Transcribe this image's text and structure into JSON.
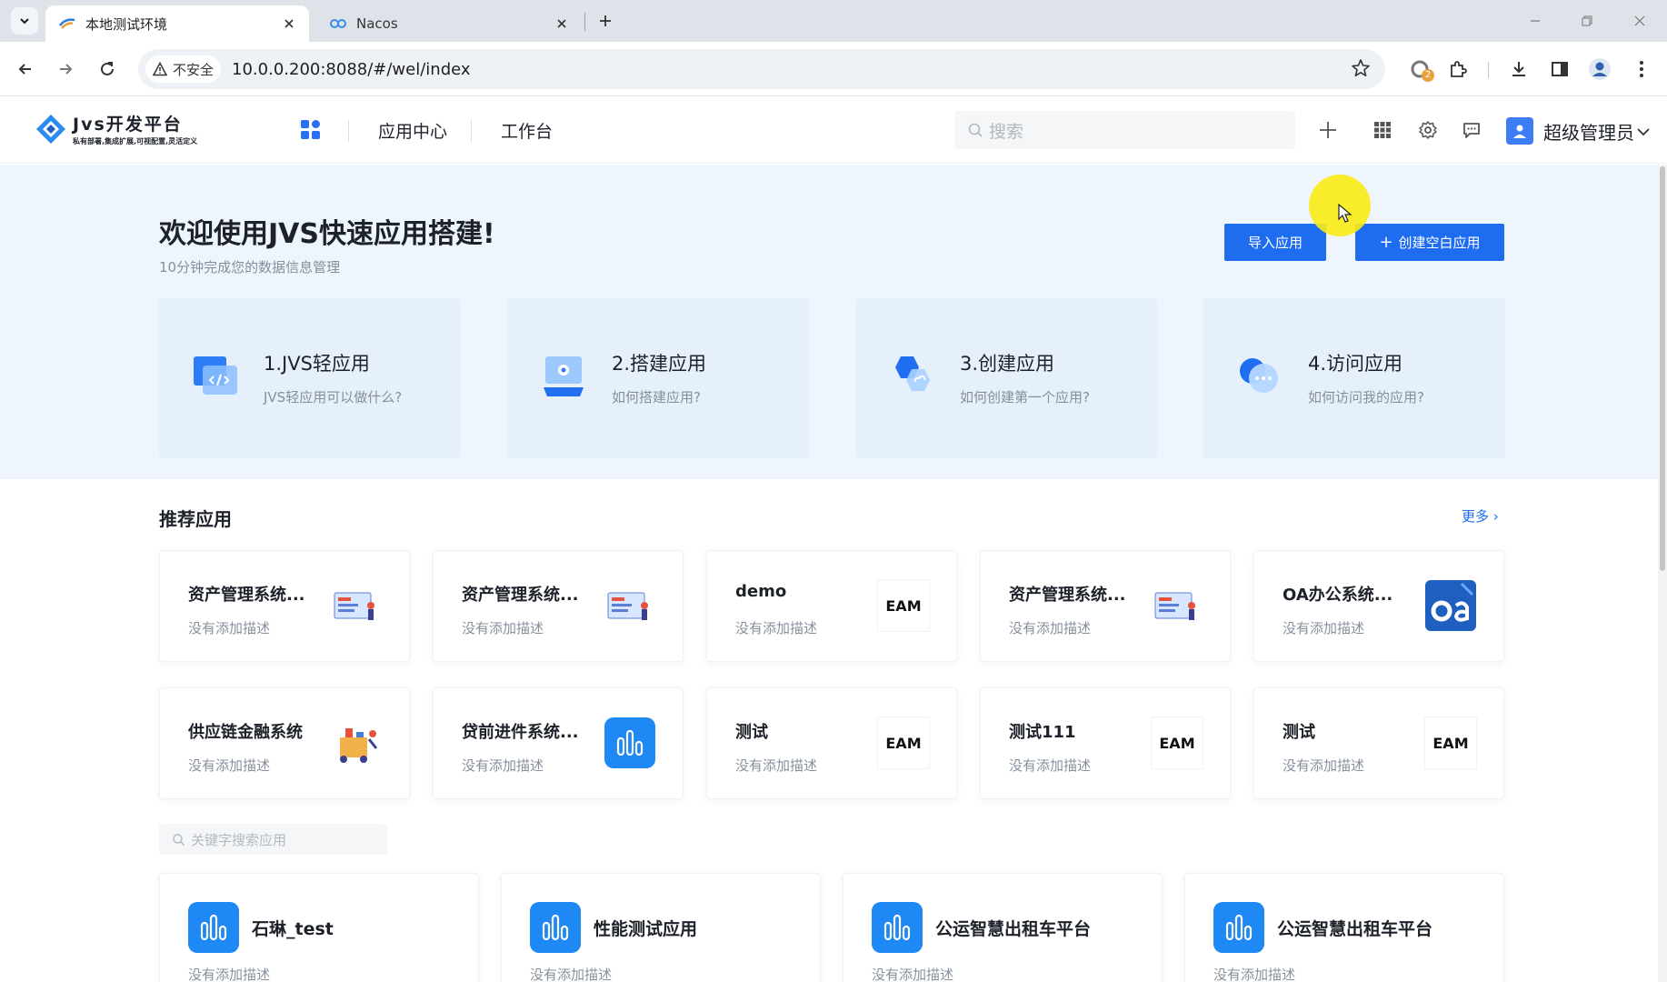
{
  "browser": {
    "tabs": [
      {
        "title": "本地测试环境",
        "active": true
      },
      {
        "title": "Nacos",
        "active": false
      }
    ],
    "security_label": "不安全",
    "url": "10.0.0.200:8088/#/wel/index",
    "extension_badge": "2"
  },
  "header": {
    "logo_title": "Jvs开发平台",
    "logo_subtitle": "私有部署,集成扩展,可视配置,灵活定义",
    "nav": [
      "应用中心",
      "工作台"
    ],
    "search_placeholder": "搜索",
    "user_name": "超级管理员"
  },
  "hero": {
    "title": "欢迎使用JVS快速应用搭建!",
    "subtitle": "10分钟完成您的数据信息管理",
    "import_button": "导入应用",
    "create_button": "创建空白应用",
    "guides": [
      {
        "title": "1.JVS轻应用",
        "desc": "JVS轻应用可以做什么?",
        "icon": "code-window-icon"
      },
      {
        "title": "2.搭建应用",
        "desc": "如何搭建应用?",
        "icon": "laptop-settings-icon"
      },
      {
        "title": "3.创建应用",
        "desc": "如何创建第一个应用?",
        "icon": "hexagon-link-icon"
      },
      {
        "title": "4.访问应用",
        "desc": "如何访问我的应用?",
        "icon": "chat-bubble-icon"
      }
    ]
  },
  "recommended": {
    "title": "推荐应用",
    "more": "更多",
    "apps": [
      {
        "name": "资产管理系统...",
        "desc": "没有添加描述",
        "thumb": "asset-illustration"
      },
      {
        "name": "资产管理系统...",
        "desc": "没有添加描述",
        "thumb": "asset-illustration"
      },
      {
        "name": "demo",
        "desc": "没有添加描述",
        "thumb": "EAM"
      },
      {
        "name": "资产管理系统...",
        "desc": "没有添加描述",
        "thumb": "asset-illustration"
      },
      {
        "name": "OA办公系统...",
        "desc": "没有添加描述",
        "thumb": "oa-logo"
      },
      {
        "name": "供应链金融系统",
        "desc": "没有添加描述",
        "thumb": "supply-chain-illustration"
      },
      {
        "name": "贷前进件系统...",
        "desc": "没有添加描述",
        "thumb": "bar-chart-tile"
      },
      {
        "name": "测试",
        "desc": "没有添加描述",
        "thumb": "EAM"
      },
      {
        "name": "测试111",
        "desc": "没有添加描述",
        "thumb": "EAM"
      },
      {
        "name": "测试",
        "desc": "没有添加描述",
        "thumb": "EAM"
      }
    ]
  },
  "app_search_placeholder": "关键字搜索应用",
  "my_apps": [
    {
      "name": "石琳_test",
      "desc": "没有添加描述"
    },
    {
      "name": "性能测试应用",
      "desc": "没有添加描述"
    },
    {
      "name": "公运智慧出租车平台",
      "desc": "没有添加描述"
    },
    {
      "name": "公运智慧出租车平台",
      "desc": "没有添加描述"
    }
  ],
  "colors": {
    "primary": "#1e6df0",
    "hero_bg": "#eef5fc",
    "tile_blue": "#1e88f5"
  }
}
